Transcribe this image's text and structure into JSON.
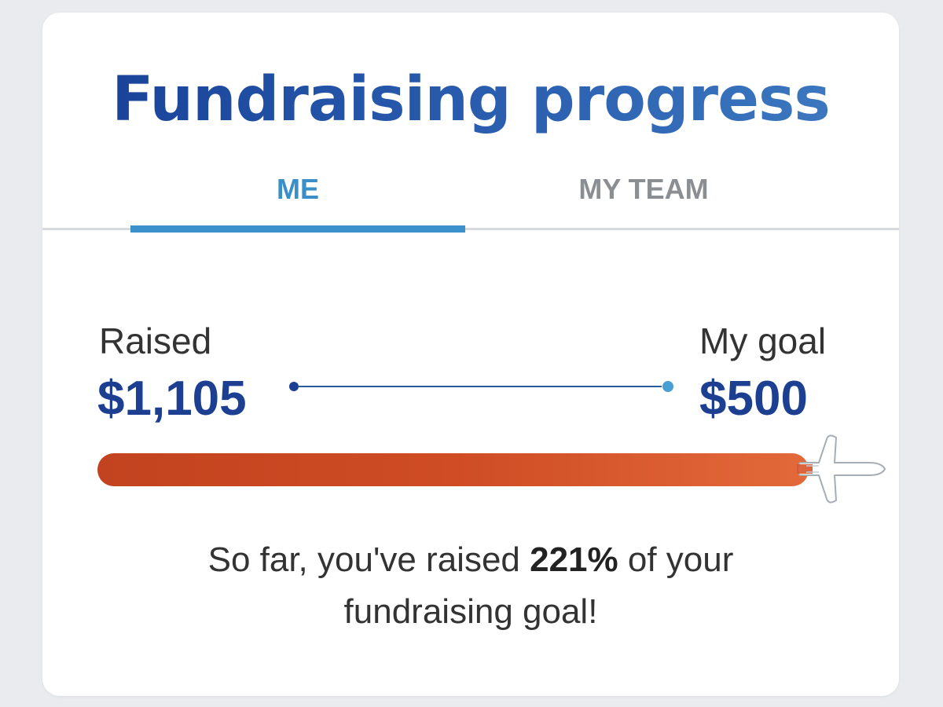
{
  "header": {
    "title": "Fundraising progress"
  },
  "tabs": [
    {
      "label": "ME",
      "selected": true
    },
    {
      "label": "MY TEAM",
      "selected": false
    }
  ],
  "progress": {
    "raised_label": "Raised",
    "raised_value": "$1,105",
    "goal_label": "My goal",
    "goal_value": "$500",
    "percent_value": 221,
    "bar_fill_fraction": 1.0,
    "marker_icon": "airplane-icon"
  },
  "summary": {
    "prefix": "So far, you've raised ",
    "percent": "221%",
    "suffix_line1": " of your",
    "line2": "fundraising goal!"
  },
  "colors": {
    "title": "#1f4fa0",
    "tab_active": "#3a8fc8",
    "tab_inactive": "#8b8e93",
    "amount": "#1c3f92",
    "bar": "#cf4c24"
  }
}
